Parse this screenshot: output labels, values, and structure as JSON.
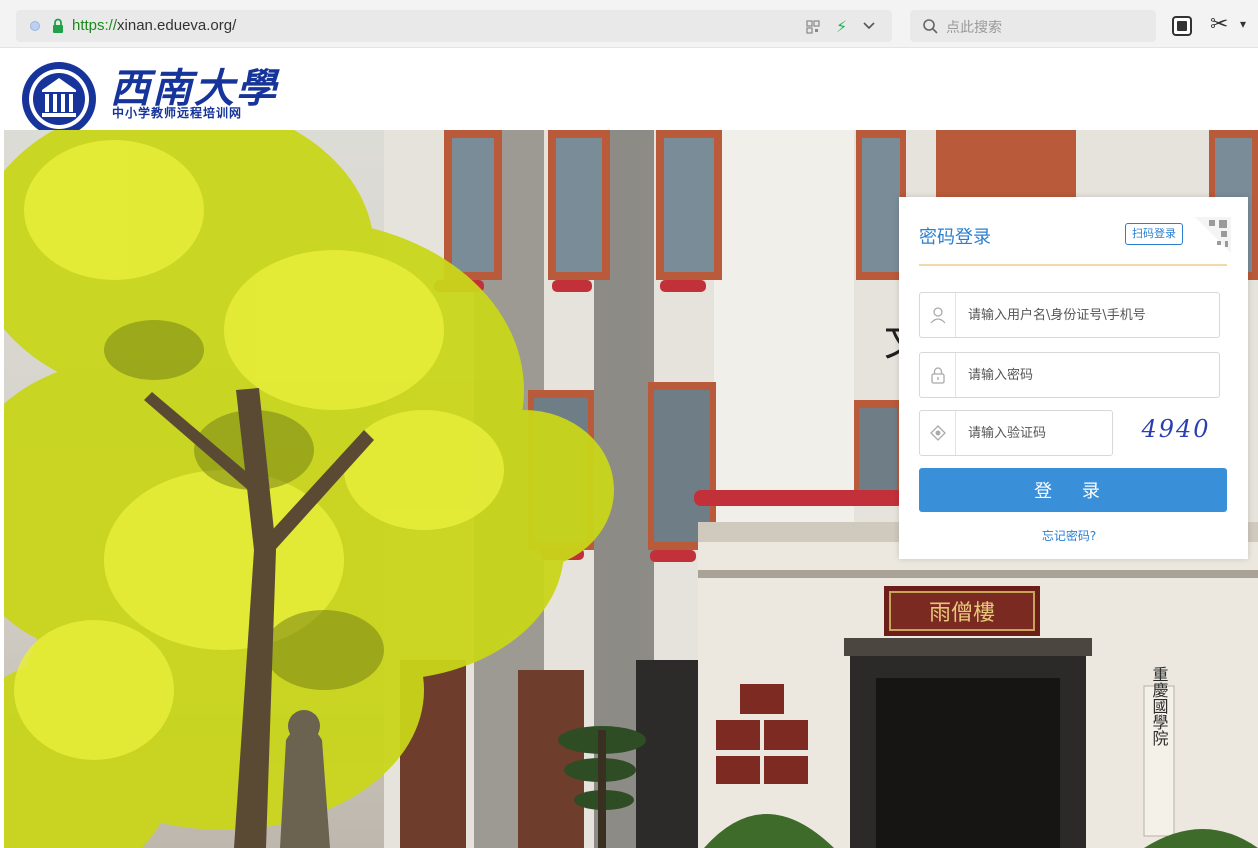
{
  "browser": {
    "url_scheme": "https://",
    "url_rest": "xinan.edueva.org/",
    "search_placeholder": "点此搜索",
    "icons": [
      "dot-icon",
      "lock-icon",
      "qr-code-icon",
      "bolt-icon",
      "chevron-down-icon",
      "search-icon",
      "extension-icon",
      "scissors-icon"
    ]
  },
  "header": {
    "logo_title": "西南大學",
    "logo_subtitle": "中小学教师远程培训网"
  },
  "hero": {
    "plaque_text": "雨僧樓",
    "door_sign": "重慶國學院",
    "wall_char": "文"
  },
  "login": {
    "title": "密码登录",
    "scan_login_label": "扫码登录",
    "username_placeholder": "请输入用户名\\身份证号\\手机号",
    "password_placeholder": "请输入密码",
    "captcha_placeholder": "请输入验证码",
    "captcha_code": "4940",
    "login_button": "登 录",
    "forgot_password": "忘记密码?"
  },
  "colors": {
    "accent_blue": "#3a8fd9",
    "link_blue": "#2b7fd1",
    "logo_blue": "#17349a",
    "rule_gold": "#f3d9a8",
    "https_green": "#1a8a1a"
  }
}
